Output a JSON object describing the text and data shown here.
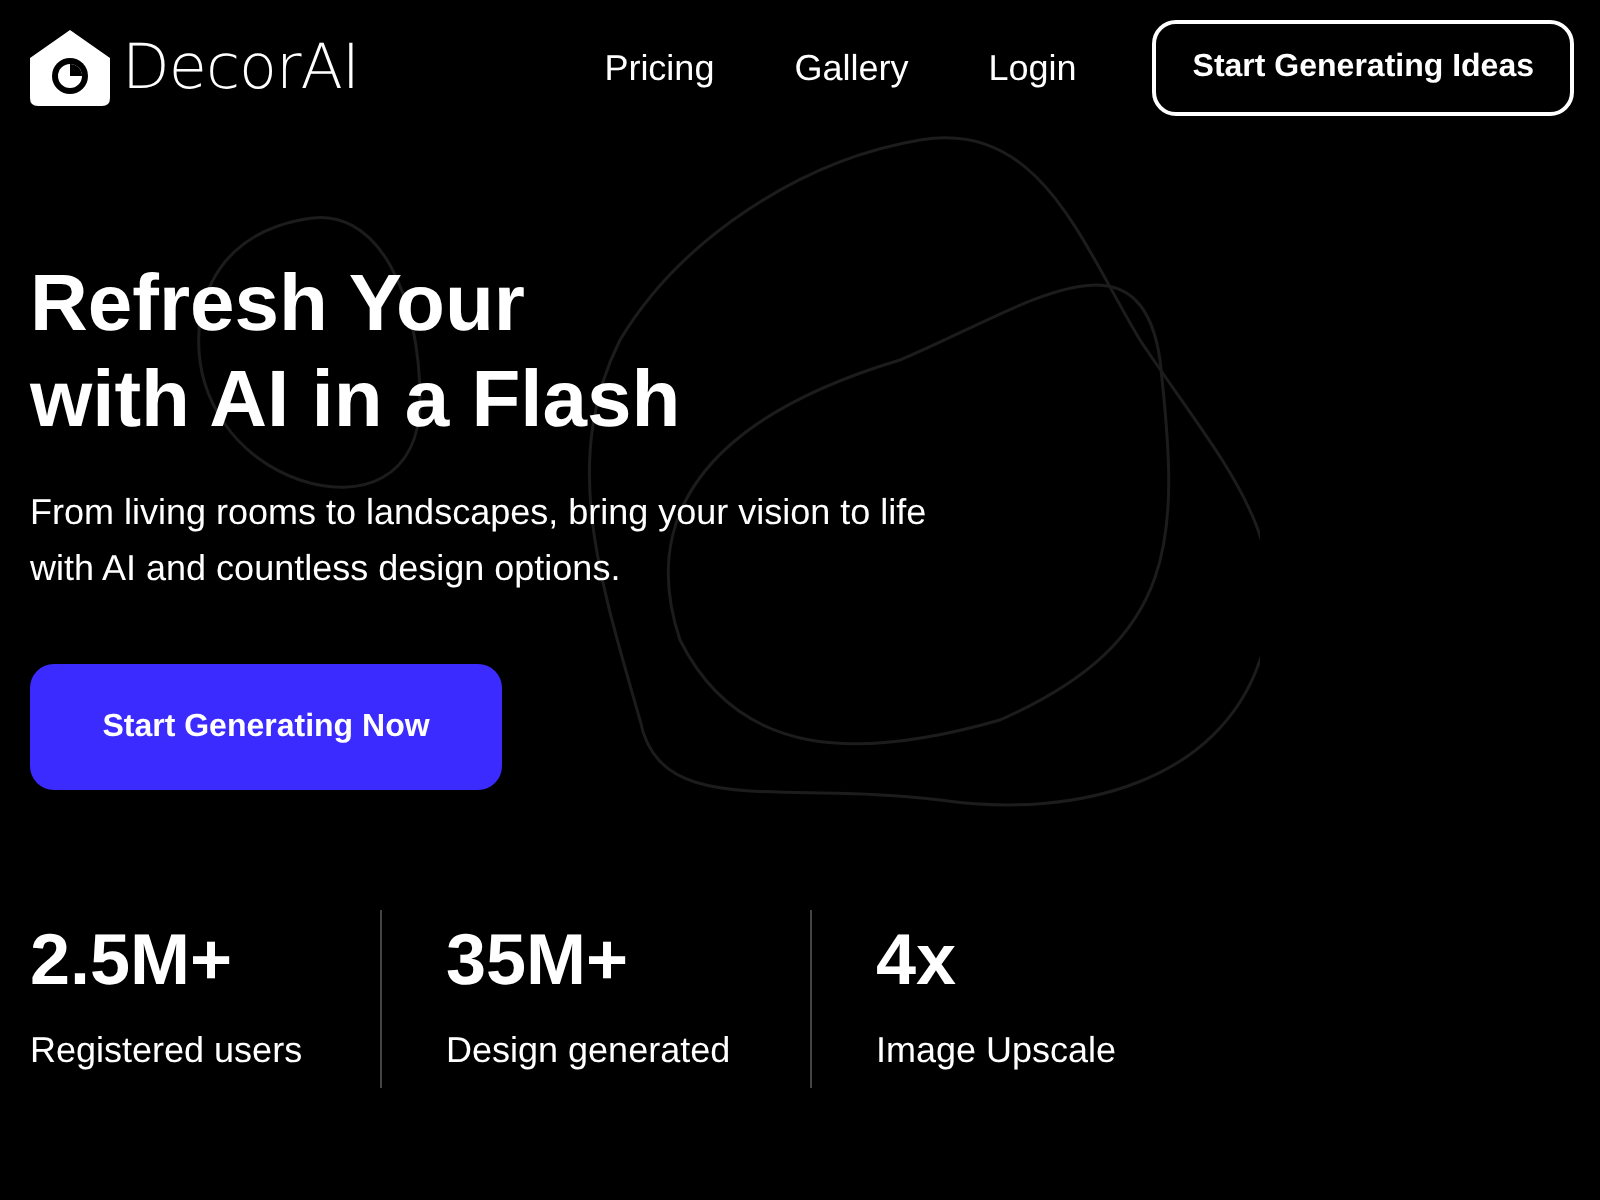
{
  "brand": {
    "name": "DecorAI"
  },
  "nav": {
    "links": [
      "Pricing",
      "Gallery",
      "Login"
    ],
    "cta": "Start Generating Ideas"
  },
  "hero": {
    "title_lines": [
      "Refresh Your",
      "with AI in a Flash"
    ],
    "subtitle": "From living rooms to landscapes, bring your vision to life with AI and countless design options.",
    "button": "Start Generating Now"
  },
  "stats": [
    {
      "value": "2.5M+",
      "label": "Registered users"
    },
    {
      "value": "35M+",
      "label": "Design generated"
    },
    {
      "value": "4x",
      "label": "Image Upscale"
    }
  ]
}
